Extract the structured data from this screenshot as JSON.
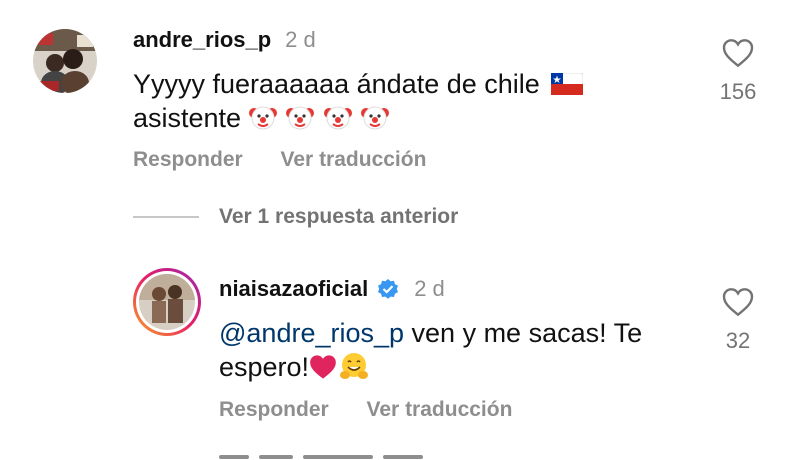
{
  "comments": [
    {
      "username": "andre_rios_p",
      "time": "2 d",
      "text": "Yyyyy fueraaaaaa ándate de chile",
      "text_line2": "asistente",
      "likes": "156",
      "reply_label": "Responder",
      "translate_label": "Ver traducción"
    },
    {
      "username": "niaisazaoficial",
      "time": "2 d",
      "mention": "@andre_rios_p",
      "text": " ven y me sacas! Te",
      "text_line2": "espero!",
      "likes": "32",
      "reply_label": "Responder",
      "translate_label": "Ver traducción"
    }
  ],
  "replies_toggle_label": "Ver 1 respuesta anterior",
  "colors": {
    "muted": "#8e8e8e",
    "mention": "#00376b",
    "verified": "#3897f0"
  },
  "icons": [
    "heart-outline-icon",
    "verified-badge-icon",
    "chile-flag-icon",
    "clown-emoji-icon",
    "red-heart-emoji-icon",
    "hugging-emoji-icon"
  ]
}
